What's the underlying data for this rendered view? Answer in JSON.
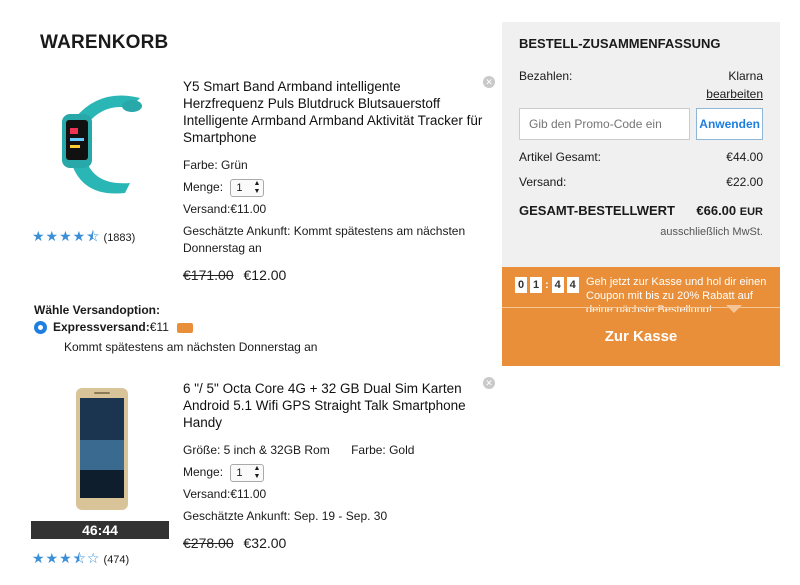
{
  "cart": {
    "title": "WARENKORB"
  },
  "products": [
    {
      "title": "Y5 Smart Band Armband intelligente Herzfrequenz Puls Blutdruck Blutsauerstoff Intelligente Armband Armband Aktivität Tracker für Smartphone",
      "color_label": "Farbe: Grün",
      "qty_label": "Menge:",
      "qty_value": "1",
      "shipping": "Versand:€11.00",
      "arrival": "Geschätzte Ankunft: Kommt spätestens am nächsten Donnerstag an",
      "old_price": "€171.00",
      "price": "€12.00",
      "rating_count": "(1883)"
    },
    {
      "title": "6 \"/ 5\" Octa Core 4G + 32 GB Dual Sim Karten Android 5.1 Wifi GPS Straight Talk Smartphone Handy",
      "size_label": "Größe: 5 inch & 32GB Rom",
      "color_label": "Farbe: Gold",
      "qty_label": "Menge:",
      "qty_value": "1",
      "shipping": "Versand:€11.00",
      "arrival": "Geschätzte Ankunft: Sep. 19 - Sep. 30",
      "old_price": "€278.00",
      "price": "€32.00",
      "rating_count": "(474)",
      "timer": "46:44"
    }
  ],
  "shipping_option": {
    "heading": "Wähle Versandoption:",
    "name": "Expressversand:",
    "price": "€11",
    "note": "Kommt spätestens am nächsten Donnerstag an"
  },
  "summary": {
    "title": "BESTELL-ZUSAMMENFASSUNG",
    "pay_label": "Bezahlen:",
    "pay_value": "Klarna",
    "edit_link": "bearbeiten",
    "promo_placeholder": "Gib den Promo-Code ein",
    "apply_label": "Anwenden",
    "items_label": "Artikel Gesamt:",
    "items_value": "€44.00",
    "ship_label": "Versand:",
    "ship_value": "€22.00",
    "total_label": "GESAMT-BESTELLWERT",
    "total_value": "€66.00",
    "total_currency": "EUR",
    "vat": "ausschließlich MwSt."
  },
  "promo_banner": {
    "digits": [
      "0",
      "1",
      "4",
      "4"
    ],
    "text": "Geh jetzt zur Kasse und hol dir einen Coupon mit bis zu 20% Rabatt auf deine nächste Bestellung!",
    "checkout_label": "Zur Kasse"
  },
  "colors": {
    "accent": "#e98f3a",
    "link": "#1e7fe0",
    "stars": "#3a8fd8"
  },
  "icons": [
    "close-icon",
    "star-icon",
    "radio-selected-icon",
    "truck-icon",
    "select-arrows-icon"
  ]
}
